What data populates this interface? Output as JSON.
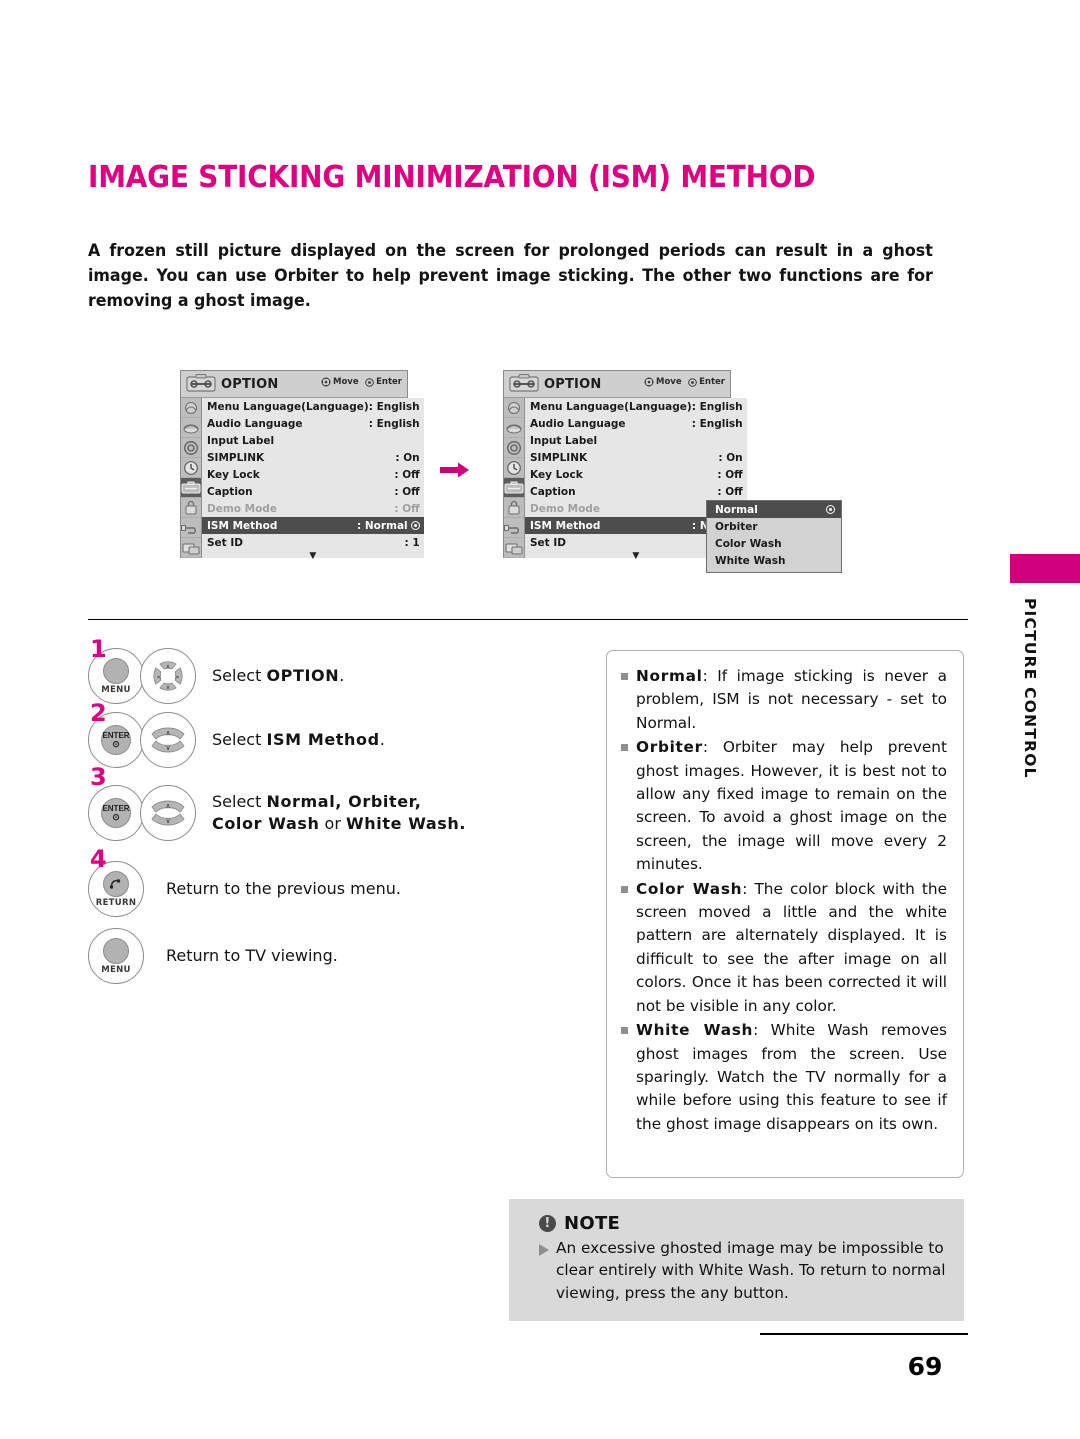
{
  "page": {
    "title": "IMAGE STICKING MINIMIZATION (ISM) METHOD",
    "intro": "A frozen still picture displayed on the screen for prolonged periods can result in a ghost image. You can use Orbiter to help prevent image sticking. The other two functions are for removing a ghost image.",
    "number": "69",
    "side_tab": "PICTURE CONTROL",
    "accent_color": "#e0007f",
    "tab_color": "#d1007c"
  },
  "osd": {
    "header": {
      "title": "OPTION",
      "move_label": "Move",
      "enter_label": "Enter"
    },
    "rows": [
      {
        "label": "Menu Language(Language)",
        "value": ": English",
        "state": "normal"
      },
      {
        "label": "Audio Language",
        "value": ": English",
        "state": "normal"
      },
      {
        "label": "Input Label",
        "value": "",
        "state": "normal"
      },
      {
        "label": "SIMPLINK",
        "value": ": On",
        "state": "normal"
      },
      {
        "label": "Key Lock",
        "value": ": Off",
        "state": "normal"
      },
      {
        "label": "Caption",
        "value": ": Off",
        "state": "normal"
      },
      {
        "label": "Demo Mode",
        "value": ": Off",
        "state": "dim"
      },
      {
        "label": "ISM Method",
        "value": ": Normal",
        "state": "selected"
      },
      {
        "label": "Set ID",
        "value": ": 1",
        "state": "normal"
      }
    ],
    "scroll_arrow": "▼",
    "popup": {
      "options": [
        {
          "label": "Normal",
          "selected": true
        },
        {
          "label": "Orbiter",
          "selected": false
        },
        {
          "label": "Color Wash",
          "selected": false
        },
        {
          "label": "White Wash",
          "selected": false
        }
      ]
    }
  },
  "steps": [
    {
      "num": "1",
      "button": "MENU",
      "nav": "dpad",
      "text_prefix": "Select ",
      "text_bold": "OPTION",
      "text_suffix": ".",
      "text_bold2": "",
      "text_line2_prefix": "",
      "text_line2_bold": "",
      "text_line2_mid": "",
      "text_line2_bold2": ""
    },
    {
      "num": "2",
      "button": "ENTER",
      "nav": "updown",
      "text_prefix": "Select ",
      "text_bold": "ISM Method",
      "text_suffix": "."
    },
    {
      "num": "3",
      "button": "ENTER",
      "nav": "updown",
      "text_prefix": "Select ",
      "text_bold": "Normal, Orbiter,",
      "text_suffix": "",
      "text_line2_bold": "Color Wash",
      "text_line2_mid": " or ",
      "text_line2_bold2": "White Wash."
    },
    {
      "num": "4",
      "button": "RETURN",
      "nav": "none",
      "text_prefix": "Return to the previous menu.",
      "text_bold": "",
      "text_suffix": ""
    },
    {
      "num": "",
      "button": "MENU",
      "nav": "none",
      "text_prefix": "Return to TV viewing.",
      "text_bold": "",
      "text_suffix": ""
    }
  ],
  "descriptions": [
    {
      "term": "Normal",
      "body": ": If image sticking is never a problem, ISM is not necessary - set to Normal."
    },
    {
      "term": "Orbiter",
      "body": ": Orbiter may help prevent ghost images. However, it is best not to allow any fixed image to remain on the screen. To avoid a ghost image on the screen, the image will move every 2 minutes."
    },
    {
      "term": "Color Wash",
      "body": ": The color block with the screen moved a little and the white pattern are alternately displayed. It is difficult to see the after image on all colors. Once it has been corrected it will not be visible in any color."
    },
    {
      "term": "White  Wash",
      "body": ": White Wash removes ghost images from the screen. Use sparingly. Watch the TV normally for a while before using this feature to see if the ghost image disappears on its own."
    }
  ],
  "note": {
    "heading": "NOTE",
    "icon_glyph": "!",
    "text": "An excessive ghosted image may be impossible to clear entirely with White Wash. To return to normal viewing, press the any button."
  }
}
